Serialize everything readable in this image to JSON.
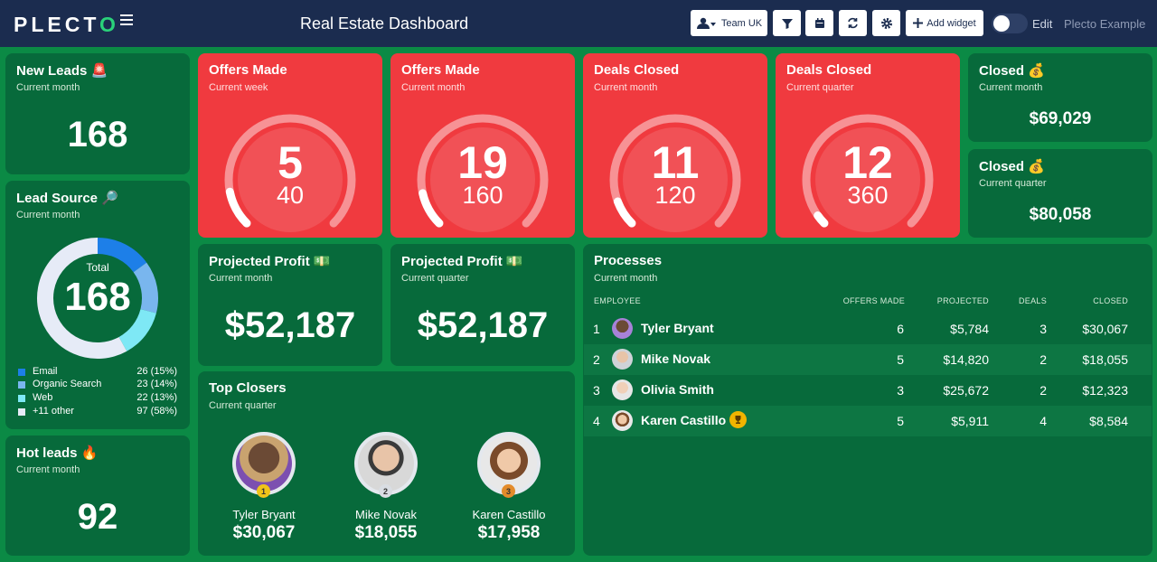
{
  "header": {
    "logo_text": "PLECTO",
    "title": "Real Estate Dashboard",
    "team_label": "Team UK",
    "add_widget_label": "Add widget",
    "edit_label": "Edit",
    "account_label": "Plecto Example",
    "edit_enabled": false
  },
  "new_leads": {
    "title": "New Leads 🚨",
    "subtitle": "Current month",
    "value": "168"
  },
  "lead_source": {
    "title": "Lead Source 🔎",
    "subtitle": "Current month",
    "total_label": "Total",
    "total_value": "168",
    "segments": [
      {
        "name": "Email",
        "value": "26 (15%)",
        "fraction": 0.15,
        "color": "#1d7fe8"
      },
      {
        "name": "Organic Search",
        "value": "23 (14%)",
        "fraction": 0.14,
        "color": "#79b6ee"
      },
      {
        "name": "Web",
        "value": "22 (13%)",
        "fraction": 0.13,
        "color": "#7ee8f5"
      },
      {
        "name": "+11 other",
        "value": "97 (58%)",
        "fraction": 0.58,
        "color": "#e6ebf7"
      }
    ]
  },
  "hot_leads": {
    "title": "Hot leads 🔥",
    "subtitle": "Current month",
    "value": "92"
  },
  "gauges": [
    {
      "title": "Offers Made",
      "subtitle": "Current week",
      "value": "5",
      "target": "40",
      "fraction": 0.125
    },
    {
      "title": "Offers Made",
      "subtitle": "Current month",
      "value": "19",
      "target": "160",
      "fraction": 0.12
    },
    {
      "title": "Deals Closed",
      "subtitle": "Current month",
      "value": "11",
      "target": "120",
      "fraction": 0.09
    },
    {
      "title": "Deals Closed",
      "subtitle": "Current quarter",
      "value": "12",
      "target": "360",
      "fraction": 0.035
    }
  ],
  "closed": [
    {
      "title": "Closed 💰",
      "subtitle": "Current month",
      "value": "$69,029"
    },
    {
      "title": "Closed 💰",
      "subtitle": "Current quarter",
      "value": "$80,058"
    }
  ],
  "projected_profit": [
    {
      "title": "Projected Profit 💵",
      "subtitle": "Current month",
      "value": "$52,187"
    },
    {
      "title": "Projected Profit 💵",
      "subtitle": "Current quarter",
      "value": "$52,187"
    }
  ],
  "top_closers": {
    "title": "Top Closers",
    "subtitle": "Current quarter",
    "people": [
      {
        "rank": "1",
        "name": "Tyler Bryant",
        "amount": "$30,067",
        "ring_color": "#f0c419"
      },
      {
        "rank": "2",
        "name": "Mike Novak",
        "amount": "$18,055",
        "ring_color": "#d9dde3"
      },
      {
        "rank": "3",
        "name": "Karen Castillo",
        "amount": "$17,958",
        "ring_color": "#e38b2a"
      }
    ]
  },
  "processes": {
    "title": "Processes",
    "subtitle": "Current month",
    "columns": [
      "EMPLOYEE",
      "OFFERS MADE",
      "PROJECTED",
      "DEALS",
      "CLOSED"
    ],
    "rows": [
      {
        "rank": "1",
        "name": "Tyler Bryant",
        "offers": "6",
        "projected": "$5,784",
        "deals": "3",
        "closed": "$30,067"
      },
      {
        "rank": "2",
        "name": "Mike Novak",
        "offers": "5",
        "projected": "$14,820",
        "deals": "2",
        "closed": "$18,055"
      },
      {
        "rank": "3",
        "name": "Olivia Smith",
        "offers": "3",
        "projected": "$25,672",
        "deals": "2",
        "closed": "$12,323"
      },
      {
        "rank": "4",
        "name": "Karen Castillo",
        "offers": "5",
        "projected": "$5,911",
        "deals": "4",
        "closed": "$8,584"
      }
    ]
  },
  "colors": {
    "background": "#0b8a45",
    "header": "#1b2c4f",
    "card": "#076a3b",
    "alert_card": "#f03a3f"
  }
}
